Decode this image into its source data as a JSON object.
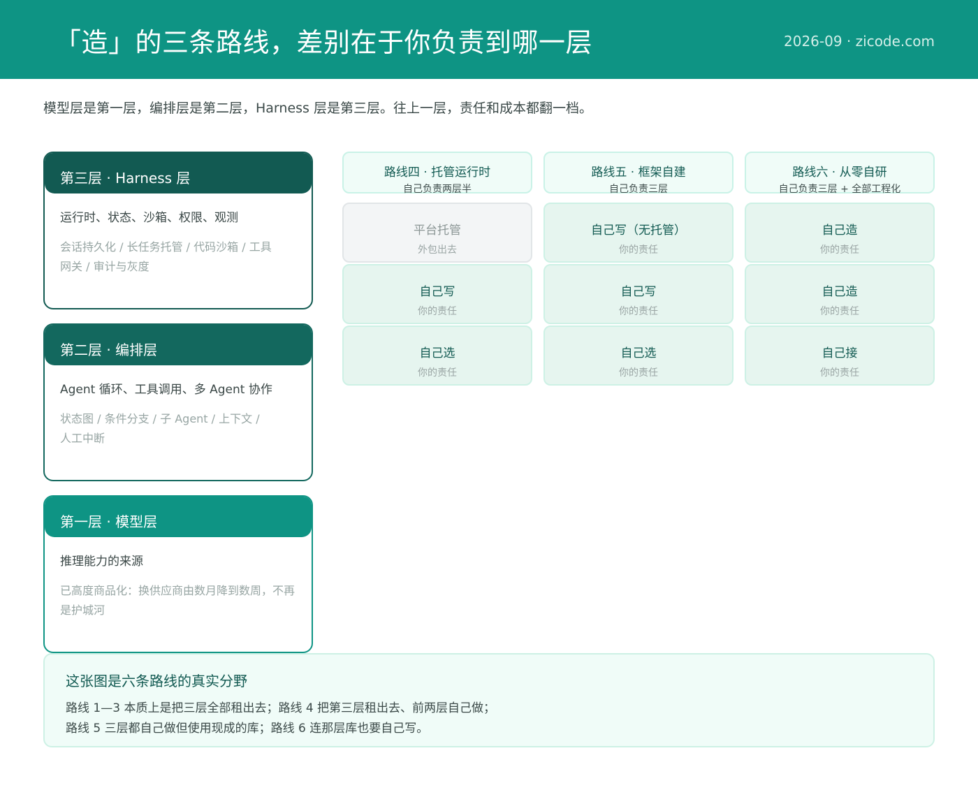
{
  "header": {
    "title": "「造」的三条路线，差别在于你负责到哪一层",
    "meta": "2026-09 · zicode.com"
  },
  "subtitle": "模型层是第一层，编排层是第二层，Harness 层是第三层。往上一层，责任和成本都翻一档。",
  "layers": [
    {
      "heading": "第三层 · Harness 层",
      "main": "运行时、状态、沙箱、权限、观测",
      "detail_lines": [
        "会话持久化 / 长任务托管 / 代码沙箱 / 工具",
        "网关 / 审计与灰度"
      ]
    },
    {
      "heading": "第二层 · 编排层",
      "main": "Agent 循环、工具调用、多 Agent 协作",
      "detail_lines": [
        "状态图 / 条件分支 / 子 Agent / 上下文 /",
        "人工中断"
      ]
    },
    {
      "heading": "第一层 · 模型层",
      "main": "推理能力的来源",
      "detail_lines": [
        "已高度商品化：换供应商由数月降到数周，不再",
        "是护城河"
      ]
    }
  ],
  "routes": [
    {
      "title": "路线四 · 托管运行时",
      "subtitle": "自己负责两层半",
      "cells": [
        {
          "title": "平台托管",
          "sub": "外包出去"
        },
        {
          "title": "自己写",
          "sub": "你的责任"
        },
        {
          "title": "自己选",
          "sub": "你的责任"
        }
      ]
    },
    {
      "title": "路线五 · 框架自建",
      "subtitle": "自己负责三层",
      "cells": [
        {
          "title": "自己写（无托管）",
          "sub": "你的责任"
        },
        {
          "title": "自己写",
          "sub": "你的责任"
        },
        {
          "title": "自己选",
          "sub": "你的责任"
        }
      ]
    },
    {
      "title": "路线六 · 从零自研",
      "subtitle": "自己负责三层 + 全部工程化",
      "cells": [
        {
          "title": "自己造",
          "sub": "你的责任"
        },
        {
          "title": "自己造",
          "sub": "你的责任"
        },
        {
          "title": "自己接",
          "sub": "你的责任"
        }
      ]
    }
  ],
  "summary": {
    "title": "这张图是六条路线的真实分野",
    "lines": [
      "路线 1—3 本质上是把三层全部租出去；路线 4 把第三层租出去、前两层自己做；",
      "路线 5 三层都自己做但使用现成的库；路线 6 连那层库也要自己写。"
    ]
  },
  "colors": {
    "header_bg": "#0e9484",
    "layer3": "#125a52",
    "layer2": "#13685e",
    "layer1": "#0e9484",
    "cell_bg": "#e6f5ef",
    "cell_outsourced_bg": "#f3f5f6"
  }
}
